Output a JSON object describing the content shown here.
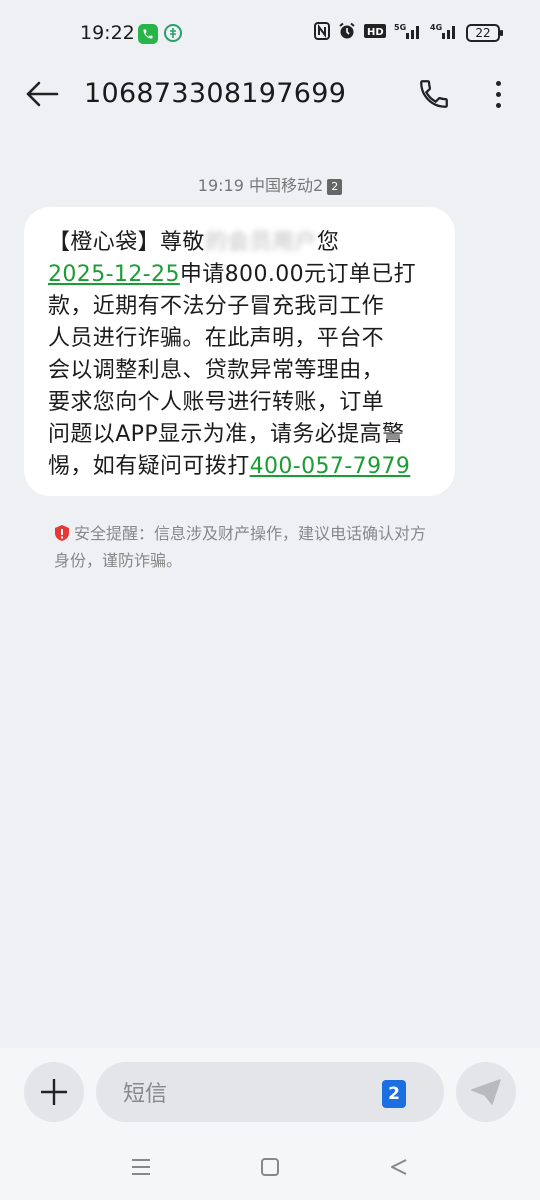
{
  "status_bar": {
    "time": "19:22",
    "battery": "22",
    "icons": [
      "nfc-icon",
      "alarm-icon",
      "hd-icon",
      "5g-signal-icon",
      "4g-signal-icon",
      "battery-icon"
    ]
  },
  "toolbar": {
    "sender": "106873308197699"
  },
  "message": {
    "time": "19:19",
    "carrier": "中国移动2",
    "sim": "2",
    "lines": [
      {
        "parts": [
          {
            "t": "【橙心袋】尊敬"
          },
          {
            "t": "的会员用户",
            "blur": true
          },
          {
            "t": "您"
          }
        ]
      },
      {
        "parts": [
          {
            "t": "2025-12-25",
            "link": true
          },
          {
            "t": "申请800.00元订单已打"
          }
        ]
      },
      {
        "parts": [
          {
            "t": "款，近期有不法分子冒充我司工作"
          }
        ]
      },
      {
        "parts": [
          {
            "t": "人员进行诈骗。在此声明，平台不"
          }
        ]
      },
      {
        "parts": [
          {
            "t": "会以调整利息、贷款异常等理由，"
          }
        ]
      },
      {
        "parts": [
          {
            "t": "要求您向个人账号进行转账，订单"
          }
        ]
      },
      {
        "parts": [
          {
            "t": "问题以APP显示为准，请务必提高警"
          }
        ]
      },
      {
        "parts": [
          {
            "t": "惕，如有疑问可拨打"
          },
          {
            "t": "400-057-7979",
            "link": true
          }
        ]
      }
    ]
  },
  "security_notice": {
    "text_line1": "安全提醒：信息涉及财产操作，建议电话确认对方",
    "text_line2": "身份，谨防诈骗。"
  },
  "input": {
    "placeholder": "短信",
    "sim": "2"
  },
  "colors": {
    "link": "#1a9d33",
    "sim_badge": "#1b6fe0",
    "warning": "#e53935"
  }
}
